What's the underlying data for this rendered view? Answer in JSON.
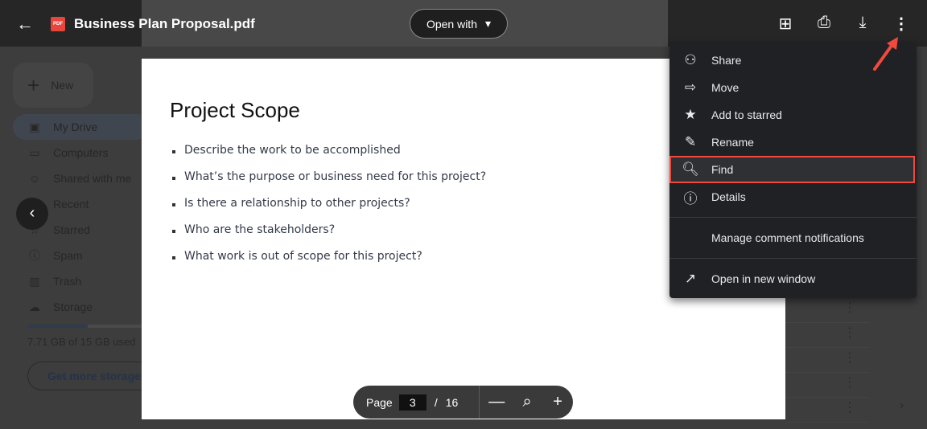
{
  "header": {
    "title": "Business Plan Proposal.pdf",
    "file_badge": "PDF",
    "open_with": "Open with"
  },
  "drive": {
    "new_label": "New",
    "nav": [
      {
        "label": "My Drive",
        "icon": "my-drive-icon"
      },
      {
        "label": "Computers",
        "icon": "computers-icon"
      },
      {
        "label": "Shared with me",
        "icon": "shared-icon"
      },
      {
        "label": "Recent",
        "icon": "clock-icon"
      },
      {
        "label": "Starred",
        "icon": "star-icon"
      },
      {
        "label": "Spam",
        "icon": "spam-icon"
      },
      {
        "label": "Trash",
        "icon": "trash-icon"
      },
      {
        "label": "Storage",
        "icon": "cloud-icon"
      }
    ],
    "storage_used": "7.71 GB of 15 GB used",
    "storage_fraction": 0.514,
    "get_more": "Get more storage"
  },
  "document": {
    "heading": "Project Scope",
    "bullets": [
      "Describe the work to be accomplished",
      "What’s the purpose or business need for this project?",
      "Is there a relationship to other projects?",
      "Who are the stakeholders?",
      "What work is out of scope for this project?"
    ]
  },
  "pager": {
    "label": "Page",
    "current": "3",
    "separator": "/",
    "total": "16"
  },
  "menu": {
    "items": [
      {
        "label": "Share",
        "icon": "person-add-icon"
      },
      {
        "label": "Move",
        "icon": "move-folder-icon"
      },
      {
        "label": "Add to starred",
        "icon": "star-icon"
      },
      {
        "label": "Rename",
        "icon": "pencil-icon"
      },
      {
        "label": "Find",
        "icon": "find-in-page-icon"
      },
      {
        "label": "Details",
        "icon": "info-icon"
      }
    ],
    "manage": "Manage comment notifications",
    "open_new": "Open in new window"
  },
  "colors": {
    "highlight": "#f04a3f",
    "pdf": "#e8453c"
  }
}
